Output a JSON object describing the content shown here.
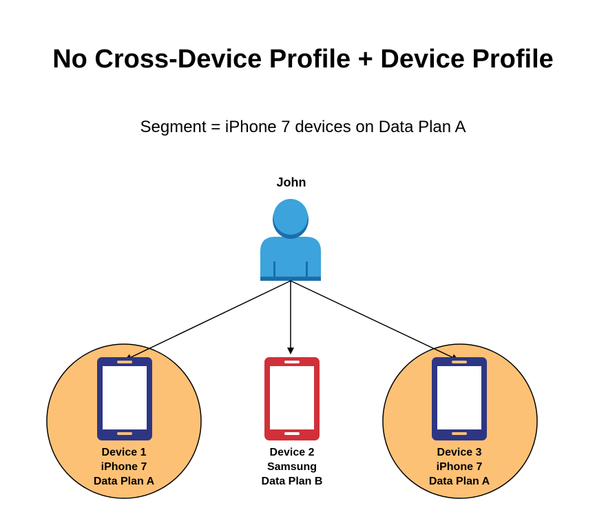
{
  "title": "No Cross-Device Profile + Device Profile",
  "subtitle": "Segment = iPhone 7 devices on Data Plan A",
  "user": {
    "name": "John",
    "icon": "person-icon",
    "color": "#3CA3DC",
    "shadow": "#1B6EA8"
  },
  "devices": [
    {
      "id": 1,
      "lines": [
        "Device 1",
        "iPhone 7",
        "Data Plan A"
      ],
      "icon": "phone-icon",
      "phone_color": "#2E3684",
      "in_segment": true
    },
    {
      "id": 2,
      "lines": [
        "Device 2",
        "Samsung",
        "Data Plan B"
      ],
      "icon": "phone-icon",
      "phone_color": "#D1303A",
      "in_segment": false
    },
    {
      "id": 3,
      "lines": [
        "Device 3",
        "iPhone 7",
        "Data Plan A"
      ],
      "icon": "phone-icon",
      "phone_color": "#2E3684",
      "in_segment": true
    }
  ],
  "colors": {
    "segment_circle": "#FDC176",
    "segment_circle_stroke": "#000000",
    "connector": "#000000"
  }
}
